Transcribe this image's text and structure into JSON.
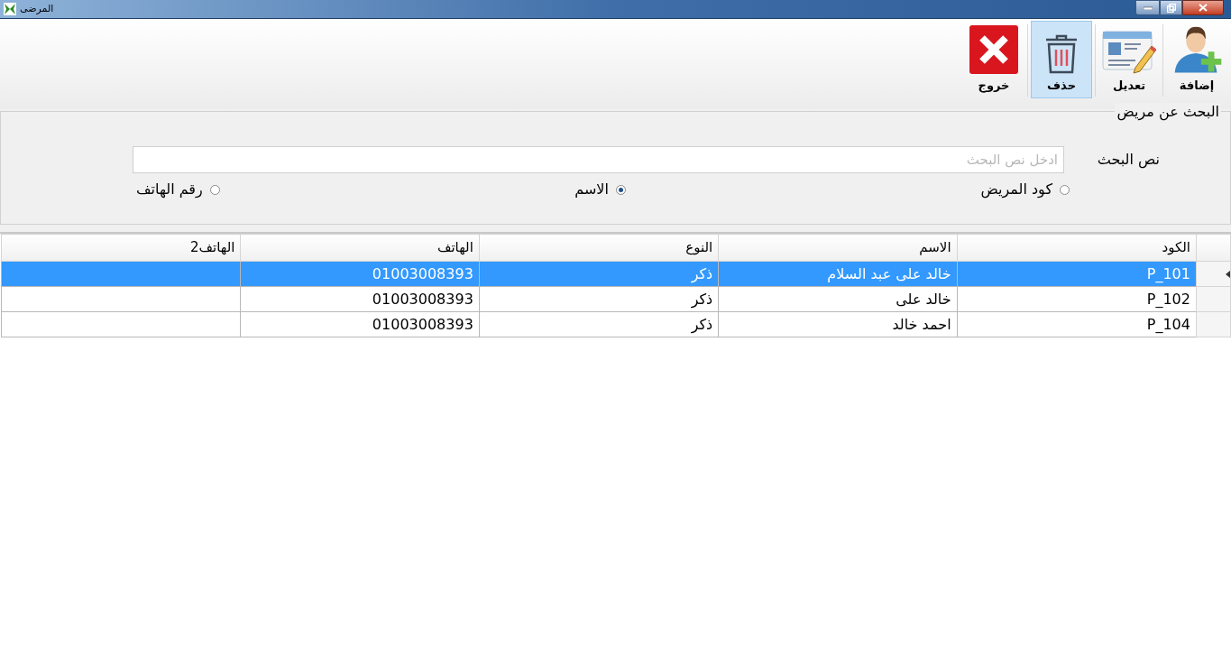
{
  "window": {
    "title": "المرضى"
  },
  "toolbar": [
    {
      "kind": "add",
      "label": "إضافة",
      "selected": false
    },
    {
      "kind": "edit",
      "label": "تعديل",
      "selected": false
    },
    {
      "kind": "delete",
      "label": "حذف",
      "selected": true
    },
    {
      "kind": "exit",
      "label": "خروج",
      "selected": false
    }
  ],
  "search": {
    "title": "البحث عن مريض",
    "label": "نص البحث",
    "placeholder": "ادخل نص البحث",
    "options": [
      {
        "label": "كود المريض",
        "selected": false
      },
      {
        "label": "الاسم",
        "selected": true
      },
      {
        "label": "رقم الهاتف",
        "selected": false
      }
    ]
  },
  "table": {
    "columns": [
      "الكود",
      "الاسم",
      "النوع",
      "الهاتف",
      "الهاتف2"
    ],
    "rows": [
      {
        "cells": [
          "P_101",
          "خالد على عبد السلام",
          "ذكر",
          "01003008393"
        ],
        "selected": true
      },
      {
        "cells": [
          "P_102",
          "خالد على",
          "ذكر",
          "01003008393"
        ],
        "selected": false
      },
      {
        "cells": [
          "P_104",
          "احمد خالد",
          "ذكر",
          "01003008393"
        ],
        "selected": false
      }
    ]
  }
}
